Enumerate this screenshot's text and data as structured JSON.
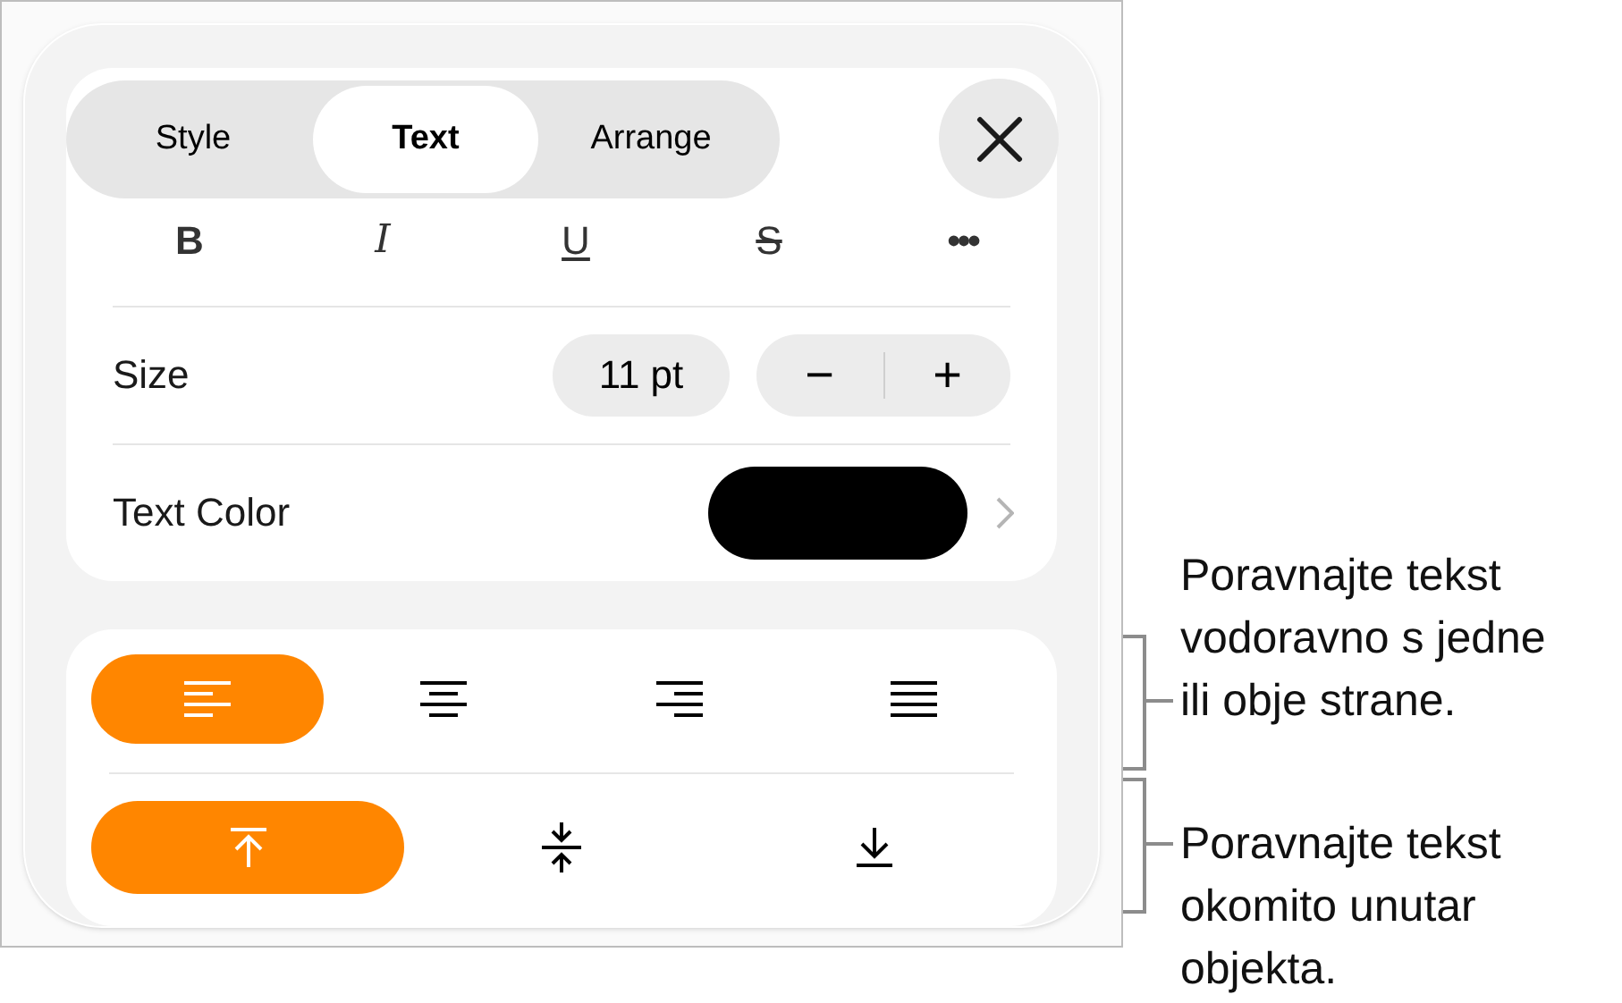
{
  "tabs": [
    {
      "label": "Style",
      "selected": false
    },
    {
      "label": "Text",
      "selected": true
    },
    {
      "label": "Arrange",
      "selected": false
    }
  ],
  "format_buttons": [
    {
      "kind": "bold",
      "label": "B"
    },
    {
      "kind": "italic",
      "label": "I"
    },
    {
      "kind": "underline",
      "label": "U"
    },
    {
      "kind": "strikethrough",
      "label": "S"
    },
    {
      "kind": "more",
      "label": "•••"
    }
  ],
  "size": {
    "label": "Size",
    "value": "11 pt",
    "decrement": "−",
    "increment": "+"
  },
  "text_color": {
    "label": "Text Color",
    "color": "#000000"
  },
  "horizontal_alignment": [
    {
      "kind": "left",
      "selected": true
    },
    {
      "kind": "center",
      "selected": false
    },
    {
      "kind": "right",
      "selected": false
    },
    {
      "kind": "justify",
      "selected": false
    }
  ],
  "vertical_alignment": [
    {
      "kind": "top",
      "selected": true
    },
    {
      "kind": "middle",
      "selected": false
    },
    {
      "kind": "bottom",
      "selected": false
    }
  ],
  "callouts": [
    {
      "lines": [
        "Poravnajte tekst",
        "vodoravno s jedne",
        "ili obje strane."
      ]
    },
    {
      "lines": [
        "Poravnajte tekst",
        "okomito unutar",
        "objekta."
      ]
    }
  ]
}
